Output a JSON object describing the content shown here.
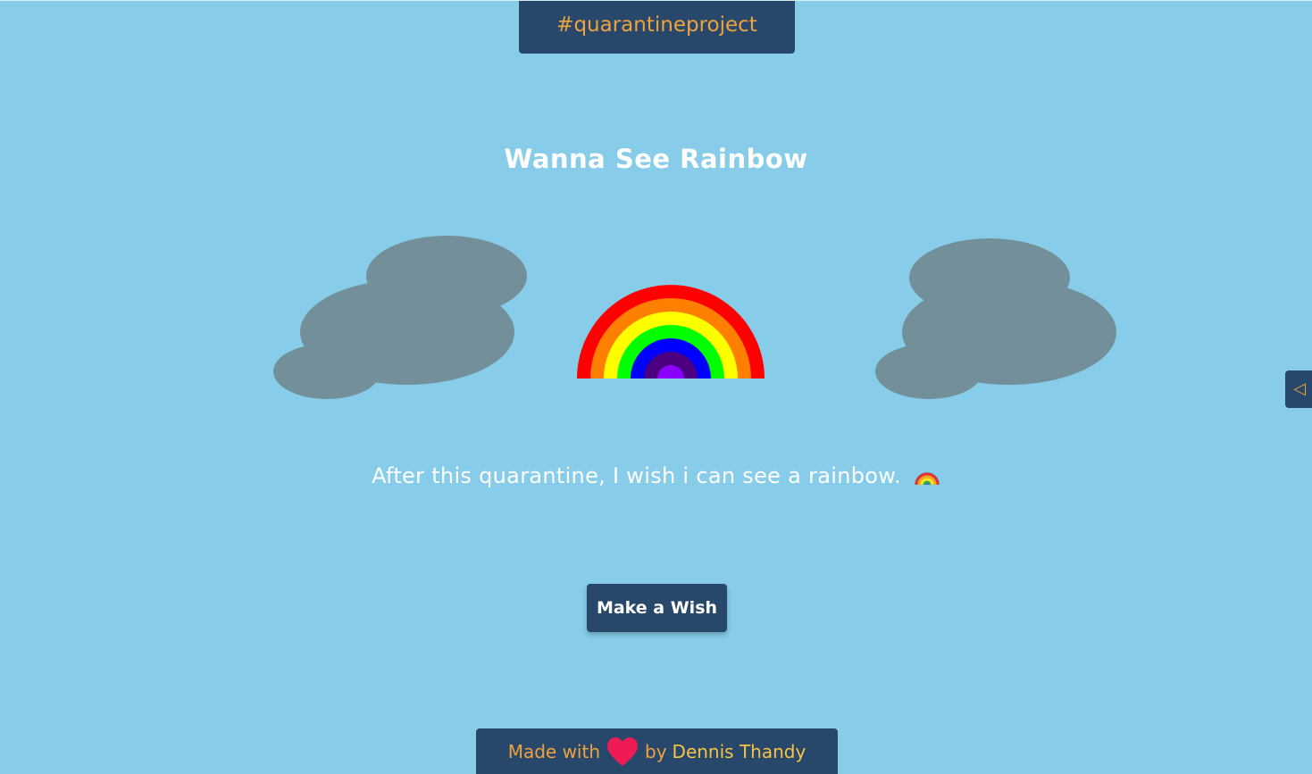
{
  "banner": {
    "tag": "#quarantineproject"
  },
  "main": {
    "title": "Wanna See Rainbow",
    "wish_text": "After this quarantine, I wish i can see a rainbow.",
    "wish_emoji": "rainbow-emoji",
    "button_label": "Make a Wish"
  },
  "footer": {
    "made_with": "Made with",
    "by": "by",
    "author": "Dennis Thandy"
  },
  "side_toggle": {
    "glyph": "◁"
  },
  "colors": {
    "sky": "#87cdea",
    "navy": "#27476b",
    "orange": "#f0a23c",
    "cloud": "#728f9a",
    "heart": "#ee1b55",
    "rainbow": [
      "#ff0000",
      "#ff7f00",
      "#ffff00",
      "#00ff00",
      "#0000ff",
      "#4b0082",
      "#8b00ff"
    ]
  }
}
